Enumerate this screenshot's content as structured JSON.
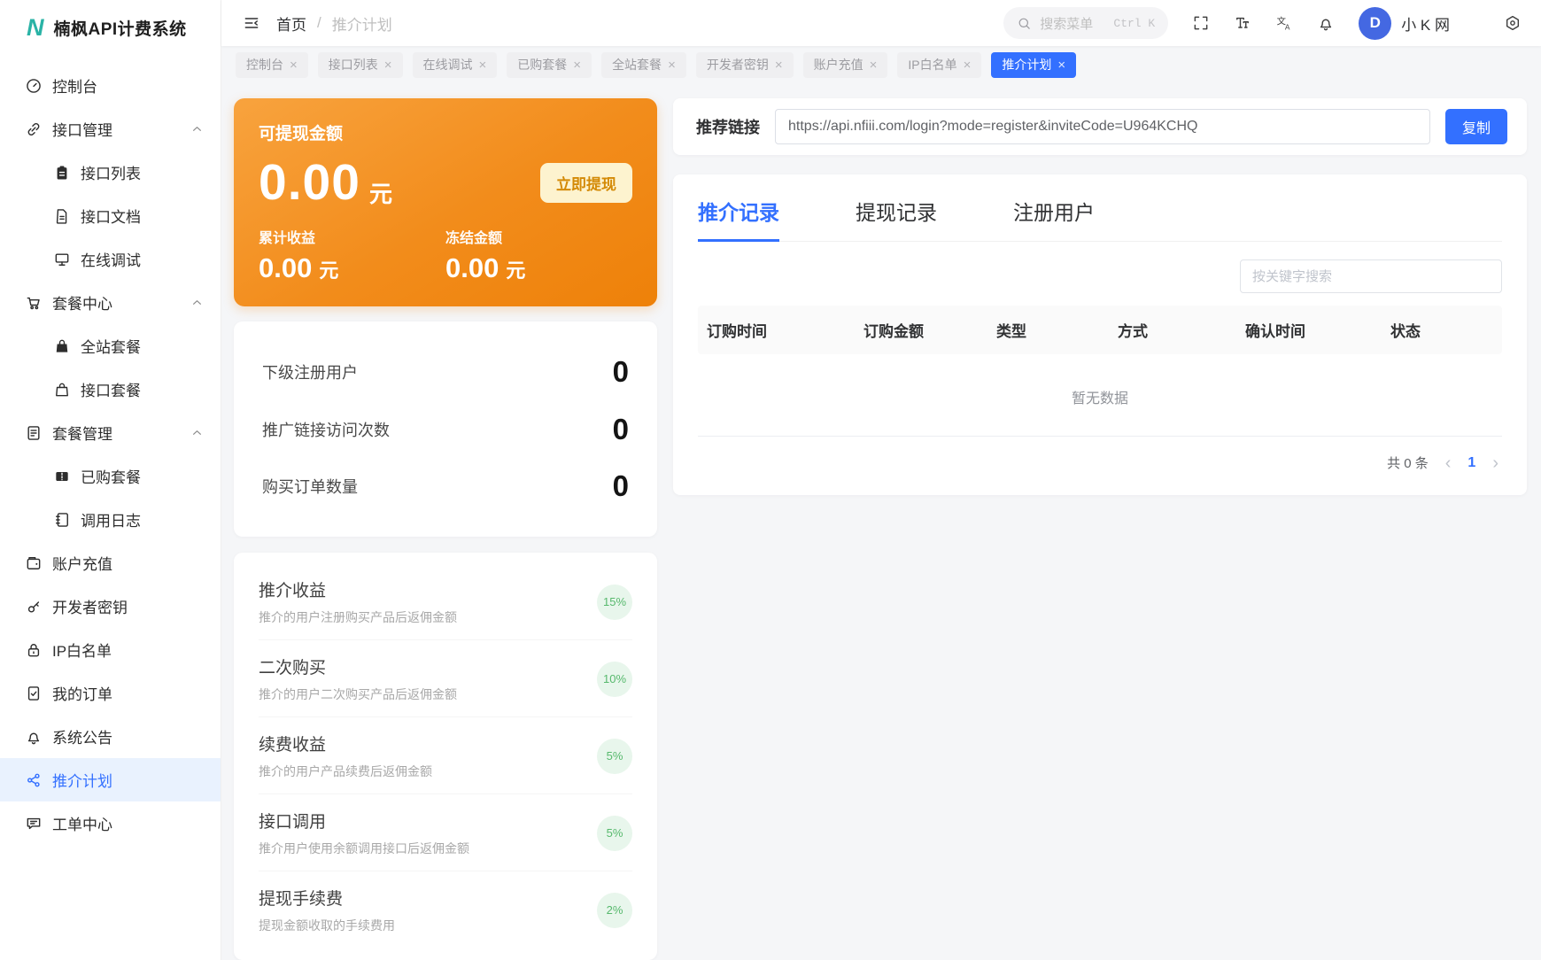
{
  "app": {
    "logo_letter": "N",
    "title": "楠枫API计费系统"
  },
  "header": {
    "breadcrumb": {
      "home": "首页",
      "separator": "/",
      "current": "推介计划"
    },
    "search_placeholder": "搜索菜单",
    "search_shortcut": "Ctrl K",
    "icons": [
      "menu-fold-icon",
      "search-icon",
      "fullscreen-icon",
      "text-size-icon",
      "translate-icon",
      "bell-icon",
      "settings-icon"
    ],
    "avatar_letter": "D",
    "user_name": "小 K 网"
  },
  "tabs_bar": {
    "tabs": [
      {
        "label": "控制台",
        "active": false
      },
      {
        "label": "接口列表",
        "active": false
      },
      {
        "label": "在线调试",
        "active": false
      },
      {
        "label": "已购套餐",
        "active": false
      },
      {
        "label": "全站套餐",
        "active": false
      },
      {
        "label": "开发者密钥",
        "active": false
      },
      {
        "label": "账户充值",
        "active": false
      },
      {
        "label": "IP白名单",
        "active": false
      },
      {
        "label": "推介计划",
        "active": true
      }
    ]
  },
  "sidebar": {
    "items": [
      {
        "label": "控制台",
        "icon": "gauge-icon",
        "level": 0
      },
      {
        "label": "接口管理",
        "icon": "link-icon",
        "level": 0,
        "expandable": true
      },
      {
        "label": "接口列表",
        "icon": "clipboard-icon",
        "level": 1
      },
      {
        "label": "接口文档",
        "icon": "document-icon",
        "level": 1
      },
      {
        "label": "在线调试",
        "icon": "monitor-icon",
        "level": 1
      },
      {
        "label": "套餐中心",
        "icon": "cart-icon",
        "level": 0,
        "expandable": true
      },
      {
        "label": "全站套餐",
        "icon": "bag-filled-icon",
        "level": 1
      },
      {
        "label": "接口套餐",
        "icon": "bag-icon",
        "level": 1
      },
      {
        "label": "套餐管理",
        "icon": "doc-list-icon",
        "level": 0,
        "expandable": true
      },
      {
        "label": "已购套餐",
        "icon": "ticket-icon",
        "level": 1
      },
      {
        "label": "调用日志",
        "icon": "journal-icon",
        "level": 1
      },
      {
        "label": "账户充值",
        "icon": "wallet-icon",
        "level": 0
      },
      {
        "label": "开发者密钥",
        "icon": "key-icon",
        "level": 0
      },
      {
        "label": "IP白名单",
        "icon": "lock-icon",
        "level": 0
      },
      {
        "label": "我的订单",
        "icon": "order-icon",
        "level": 0
      },
      {
        "label": "系统公告",
        "icon": "bell-icon",
        "level": 0
      },
      {
        "label": "推介计划",
        "icon": "share-icon",
        "level": 0,
        "active": true
      },
      {
        "label": "工单中心",
        "icon": "chat-icon",
        "level": 0
      }
    ]
  },
  "withdraw_card": {
    "title": "可提现金额",
    "amount": "0.00",
    "unit": "元",
    "withdraw_button": "立即提现",
    "stats": [
      {
        "label": "累计收益",
        "value": "0.00",
        "unit": "元"
      },
      {
        "label": "冻结金额",
        "value": "0.00",
        "unit": "元"
      }
    ]
  },
  "stats_card": {
    "rows": [
      {
        "label": "下级注册用户",
        "value": "0"
      },
      {
        "label": "推广链接访问次数",
        "value": "0"
      },
      {
        "label": "购买订单数量",
        "value": "0"
      }
    ]
  },
  "commission_card": {
    "rows": [
      {
        "title": "推介收益",
        "desc": "推介的用户注册购买产品后返佣金额",
        "rate": "15%"
      },
      {
        "title": "二次购买",
        "desc": "推介的用户二次购买产品后返佣金额",
        "rate": "10%"
      },
      {
        "title": "续费收益",
        "desc": "推介的用户产品续费后返佣金额",
        "rate": "5%"
      },
      {
        "title": "接口调用",
        "desc": "推介用户使用余额调用接口后返佣金额",
        "rate": "5%"
      },
      {
        "title": "提现手续费",
        "desc": "提现金额收取的手续费用",
        "rate": "2%"
      }
    ]
  },
  "referral": {
    "label": "推荐链接",
    "url": "https://api.nfiii.com/login?mode=register&inviteCode=U964KCHQ",
    "copy_button": "复制"
  },
  "records": {
    "tabs": [
      {
        "label": "推介记录",
        "active": true
      },
      {
        "label": "提现记录",
        "active": false
      },
      {
        "label": "注册用户",
        "active": false
      }
    ],
    "search_placeholder": "按关键字搜索",
    "columns": [
      "订购时间",
      "订购金额",
      "类型",
      "方式",
      "确认时间",
      "状态"
    ],
    "empty_text": "暂无数据",
    "pagination": {
      "total": "共 0 条",
      "page": "1"
    }
  },
  "colors": {
    "primary": "#3370ff",
    "orange_gradient_start": "#f8a33e",
    "orange_gradient_end": "#ee8109",
    "withdraw_button_bg": "#fdf3cf",
    "withdraw_button_text": "#d48a06",
    "badge_green_bg": "#e8f6ec",
    "badge_green_text": "#57b96d",
    "sidebar_active_bg": "#e9f2fe",
    "avatar_bg": "#4468e2"
  }
}
